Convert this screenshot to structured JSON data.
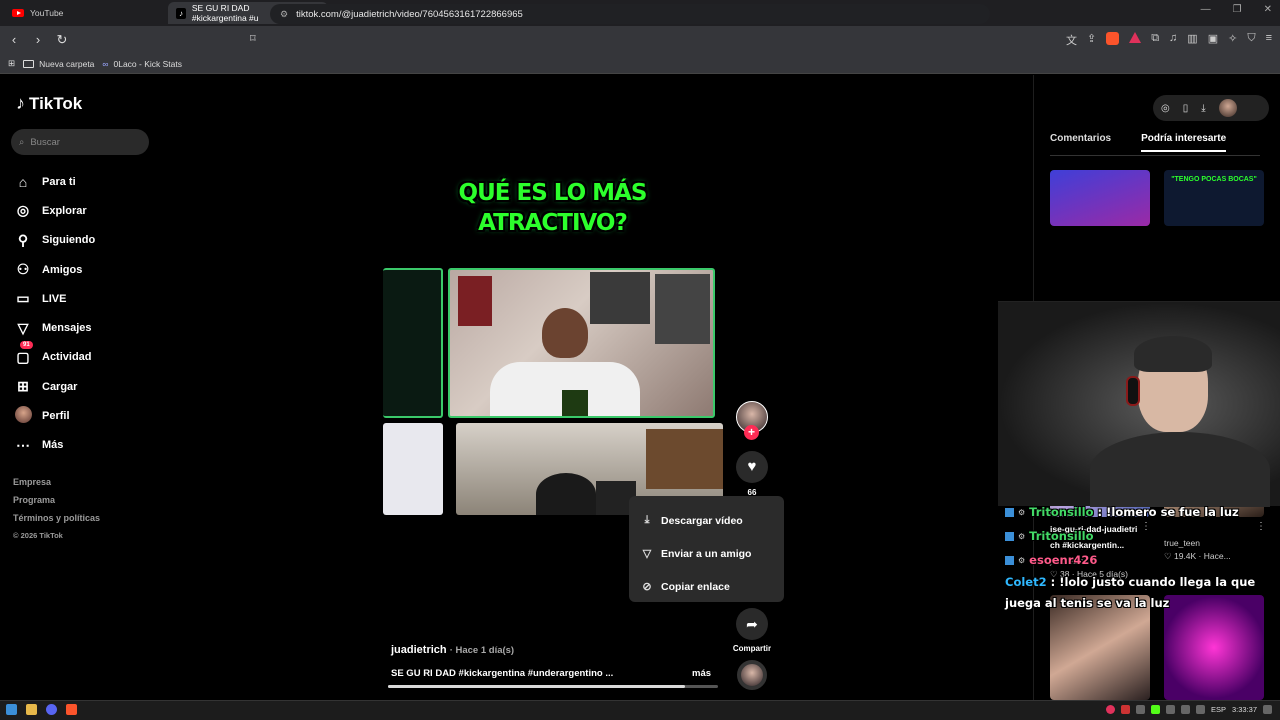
{
  "browser": {
    "tabs": [
      {
        "label": "YouTube",
        "icon": "youtube-icon"
      },
      {
        "label": "SE GU RI DAD #kickargentina #u",
        "icon": "tiktok-icon",
        "active": true
      }
    ],
    "url": "tiktok.com/@juadietrich/video/7604563161722866965",
    "bookmarks": [
      {
        "label": "Nueva carpeta",
        "icon": "folder-icon"
      },
      {
        "label": "0Laco - Kick Stats",
        "icon": "link-icon"
      }
    ]
  },
  "sidebar": {
    "logo": "TikTok",
    "search_placeholder": "Buscar",
    "items": [
      {
        "label": "Para ti",
        "icon": "home-icon"
      },
      {
        "label": "Explorar",
        "icon": "compass-icon"
      },
      {
        "label": "Siguiendo",
        "icon": "following-icon"
      },
      {
        "label": "Amigos",
        "icon": "friends-icon"
      },
      {
        "label": "LIVE",
        "icon": "live-icon"
      },
      {
        "label": "Mensajes",
        "icon": "messages-icon"
      },
      {
        "label": "Actividad",
        "icon": "activity-icon",
        "badge": "91"
      },
      {
        "label": "Cargar",
        "icon": "upload-icon"
      },
      {
        "label": "Perfil",
        "icon": "avatar"
      },
      {
        "label": "Más",
        "icon": "more-icon"
      }
    ],
    "footer": [
      "Empresa",
      "Programa",
      "Términos y políticas",
      "© 2026 TikTok"
    ]
  },
  "video": {
    "headline": "QUÉ ES LO MÁS ATRACTIVO?",
    "likes": "66",
    "share_label": "Compartir",
    "author": "juadietrich",
    "time": "· Hace 1 día(s)",
    "caption": "SE GU RI DAD #kickargentina #underargentino ...",
    "more": "más",
    "progress": 0.9
  },
  "share_menu": [
    {
      "label": "Descargar vídeo",
      "icon": "download-icon"
    },
    {
      "label": "Enviar a un amigo",
      "icon": "send-icon"
    },
    {
      "label": "Copiar enlace",
      "icon": "link-icon"
    }
  ],
  "right_panel": {
    "tabs": [
      "Comentarios",
      "Podría interesarte"
    ],
    "thumb2_text": "\"TENGO POCAS BOCAS\"",
    "cards": [
      {
        "title": "SE GU RI DAD #kickargentin...",
        "title_line1": "ise-gu-ri-dad-juadietri",
        "title_line2": "ch #kickargentin...",
        "author": "juadietrich",
        "stats": "38 · Hace 5 día(s)"
      },
      {
        "author": "true_teen",
        "stats": "19.4K · Hace..."
      }
    ]
  },
  "chat": [
    {
      "user": "Tritonsillo",
      "message": ": !lomero se fue la luz"
    },
    {
      "user": "Tritonsillo",
      "message": ""
    },
    {
      "user": "esoenr426",
      "message": ""
    },
    {
      "user": "Colet2",
      "message": ": !lolo justo cuando llega la que juega al tenis se va la luz"
    }
  ],
  "taskbar": {
    "lang": "ESP",
    "clock": "3:33:37"
  }
}
